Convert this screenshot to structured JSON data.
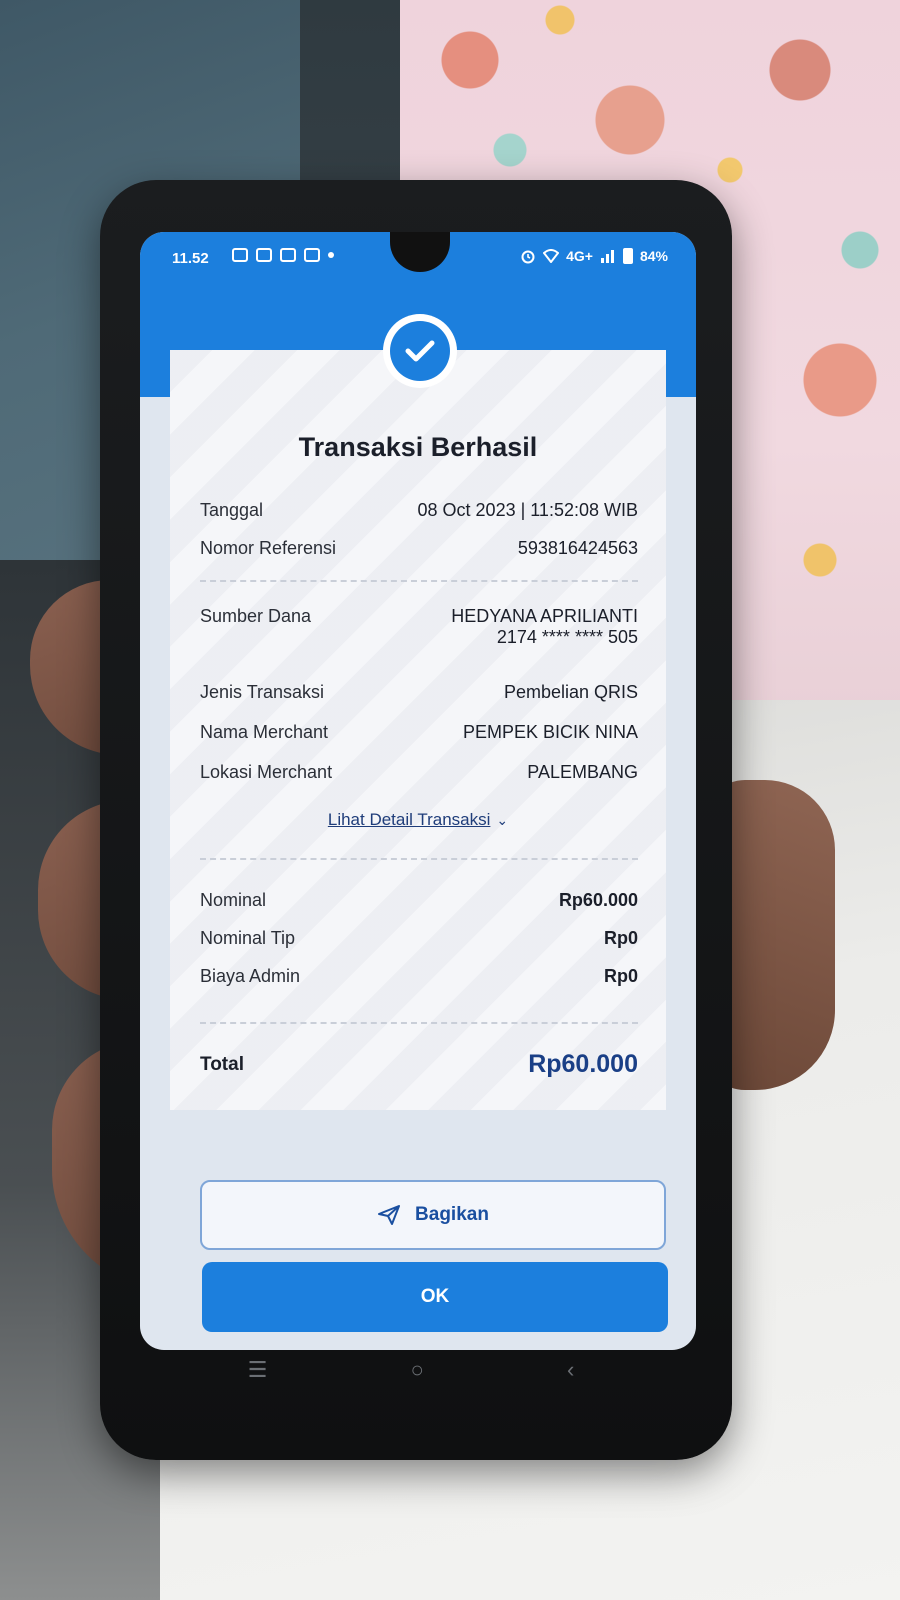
{
  "status_bar": {
    "time": "11.52",
    "network": "4G+",
    "battery": "84%"
  },
  "receipt": {
    "title": "Transaksi Berhasil",
    "rows_top": [
      {
        "label": "Tanggal",
        "value": "08 Oct 2023 | 11:52:08 WIB"
      },
      {
        "label": "Nomor Referensi",
        "value": "593816424563"
      }
    ],
    "source": {
      "label": "Sumber Dana",
      "name": "HEDYANA APRILIANTI",
      "account": "2174 **** **** 505"
    },
    "rows_mid": [
      {
        "label": "Jenis Transaksi",
        "value": "Pembelian QRIS"
      },
      {
        "label": "Nama Merchant",
        "value": "PEMPEK BICIK NINA"
      },
      {
        "label": "Lokasi Merchant",
        "value": "PALEMBANG"
      }
    ],
    "detail_link": "Lihat Detail Transaksi",
    "amounts": [
      {
        "label": "Nominal",
        "value": "Rp60.000"
      },
      {
        "label": "Nominal Tip",
        "value": "Rp0"
      },
      {
        "label": "Biaya Admin",
        "value": "Rp0"
      }
    ],
    "total_label": "Total",
    "total_value": "Rp60.000"
  },
  "buttons": {
    "share": "Bagikan",
    "ok": "OK"
  },
  "colors": {
    "primary": "#1c7fdd",
    "total_text": "#1a3f86"
  }
}
